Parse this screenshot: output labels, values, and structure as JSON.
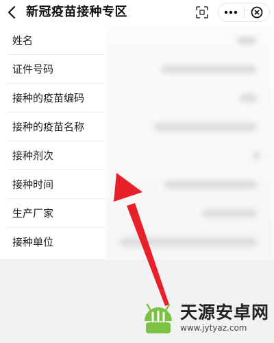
{
  "navbar": {
    "title": "新冠疫苗接种专区",
    "icons": [
      "back-chevron-icon",
      "scan-icon",
      "more-icon",
      "close-circle-icon"
    ]
  },
  "fields": [
    {
      "label": "姓名"
    },
    {
      "label": "证件号码"
    },
    {
      "label": "接种的疫苗编码"
    },
    {
      "label": "接种的疫苗名称"
    },
    {
      "label": "接种剂次"
    },
    {
      "label": "接种时间"
    },
    {
      "label": "生产厂家"
    },
    {
      "label": "接种单位"
    }
  ],
  "annotation": {
    "color": "#e8202a",
    "icon": "red-arrow"
  },
  "watermark": {
    "name": "天源安卓网",
    "url": "www.jytyaz.com",
    "logo_color": "#7cc142",
    "icon": "android-logo"
  }
}
